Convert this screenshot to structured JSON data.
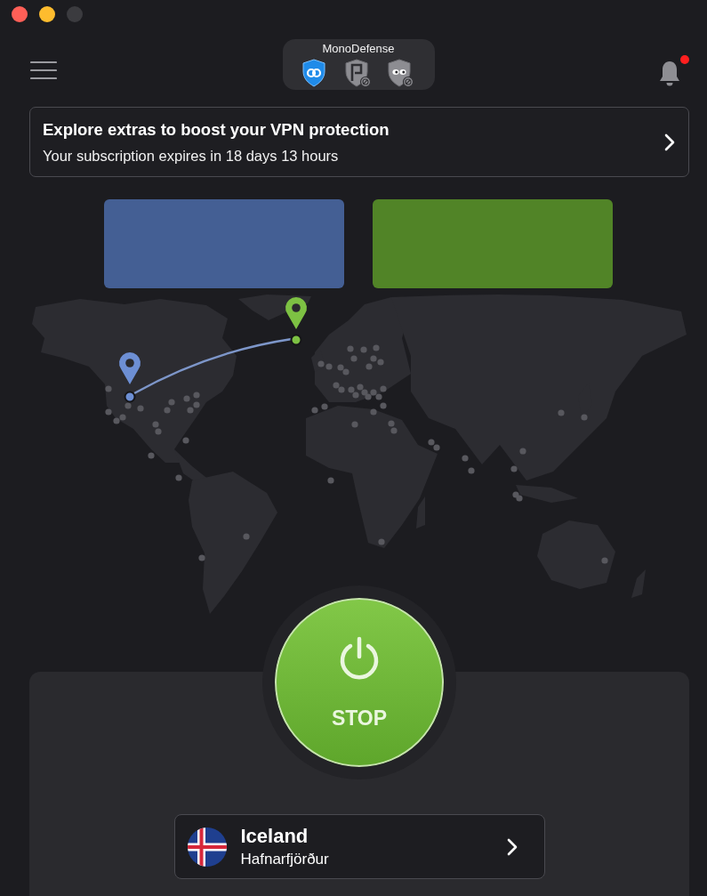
{
  "window": {
    "controls": [
      {
        "kind": "close",
        "disabled": false
      },
      {
        "kind": "minimize",
        "disabled": false
      },
      {
        "kind": "zoom",
        "disabled": true
      }
    ]
  },
  "toolbar": {
    "title": "MonoDefense",
    "apps": [
      {
        "kind": "vpn",
        "selected": true
      },
      {
        "kind": "password",
        "selected": false
      },
      {
        "kind": "privacy",
        "selected": false
      }
    ],
    "notifications": {
      "unread": true
    }
  },
  "banner": {
    "title": "Explore extras to boost your VPN protection",
    "subtitle": "Your subscription expires in 18 days 13 hours"
  },
  "info_panels": [
    {
      "color": "#445f94"
    },
    {
      "color": "#518427"
    }
  ],
  "power_button": {
    "label": "STOP",
    "connected": true
  },
  "location": {
    "country": "Iceland",
    "city": "Hafnarfjörður"
  }
}
